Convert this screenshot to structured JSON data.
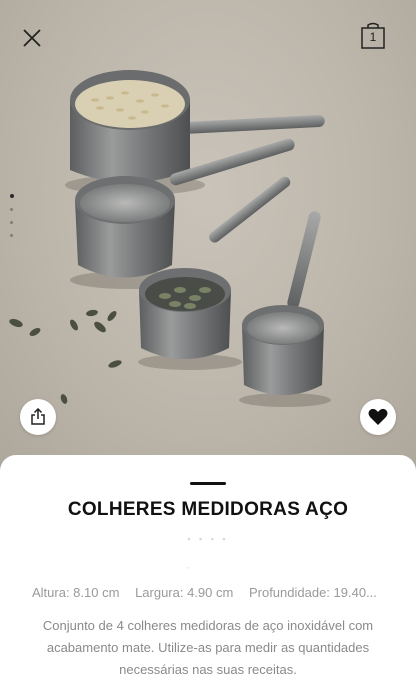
{
  "header": {
    "close_icon": "close-icon",
    "bag_icon": "shopping-bag-icon",
    "bag_count": "1"
  },
  "gallery": {
    "image_subject": "measuring-cups-photo",
    "pager_count": 4,
    "active_index": 0
  },
  "actions": {
    "share_icon": "share-icon",
    "favorite_icon": "heart-icon"
  },
  "product": {
    "title": "COLHERES MEDIDORAS AÇO",
    "dimensions": {
      "height": "Altura: 8.10 cm",
      "width": "Largura: 4.90 cm",
      "depth": "Profundidade: 19.40..."
    },
    "description": "Conjunto de 4 colheres medidoras de aço inoxidável com acabamento mate. Utilize-as para medir as quantidades necessárias nas suas receitas."
  },
  "colors": {
    "background_photo": "#bdb6ab",
    "text_primary": "#111111",
    "text_muted": "#9a9a9a"
  }
}
